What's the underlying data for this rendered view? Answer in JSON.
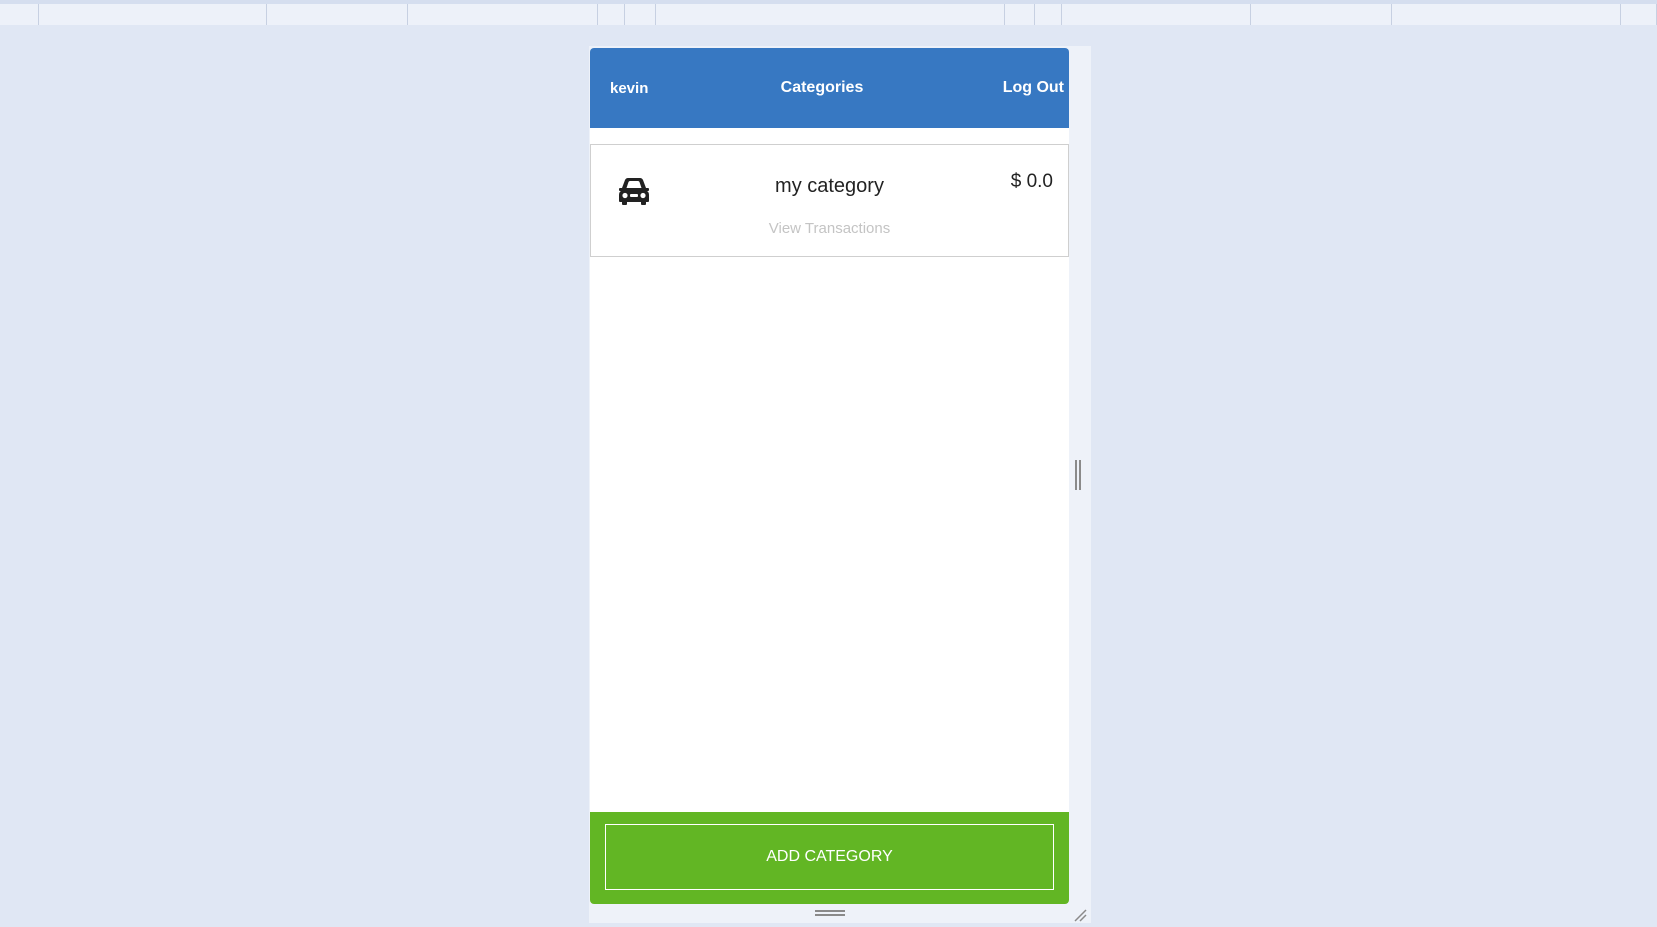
{
  "header": {
    "user": "kevin",
    "title": "Categories",
    "logout_label": "Log Out",
    "bg_color": "#3778c2"
  },
  "categories": [
    {
      "icon": "car-icon",
      "name": "my category",
      "amount": "$ 0.0",
      "link_label": "View Transactions"
    }
  ],
  "footer": {
    "add_label": "ADD CATEGORY",
    "bg_color": "#62b624"
  }
}
